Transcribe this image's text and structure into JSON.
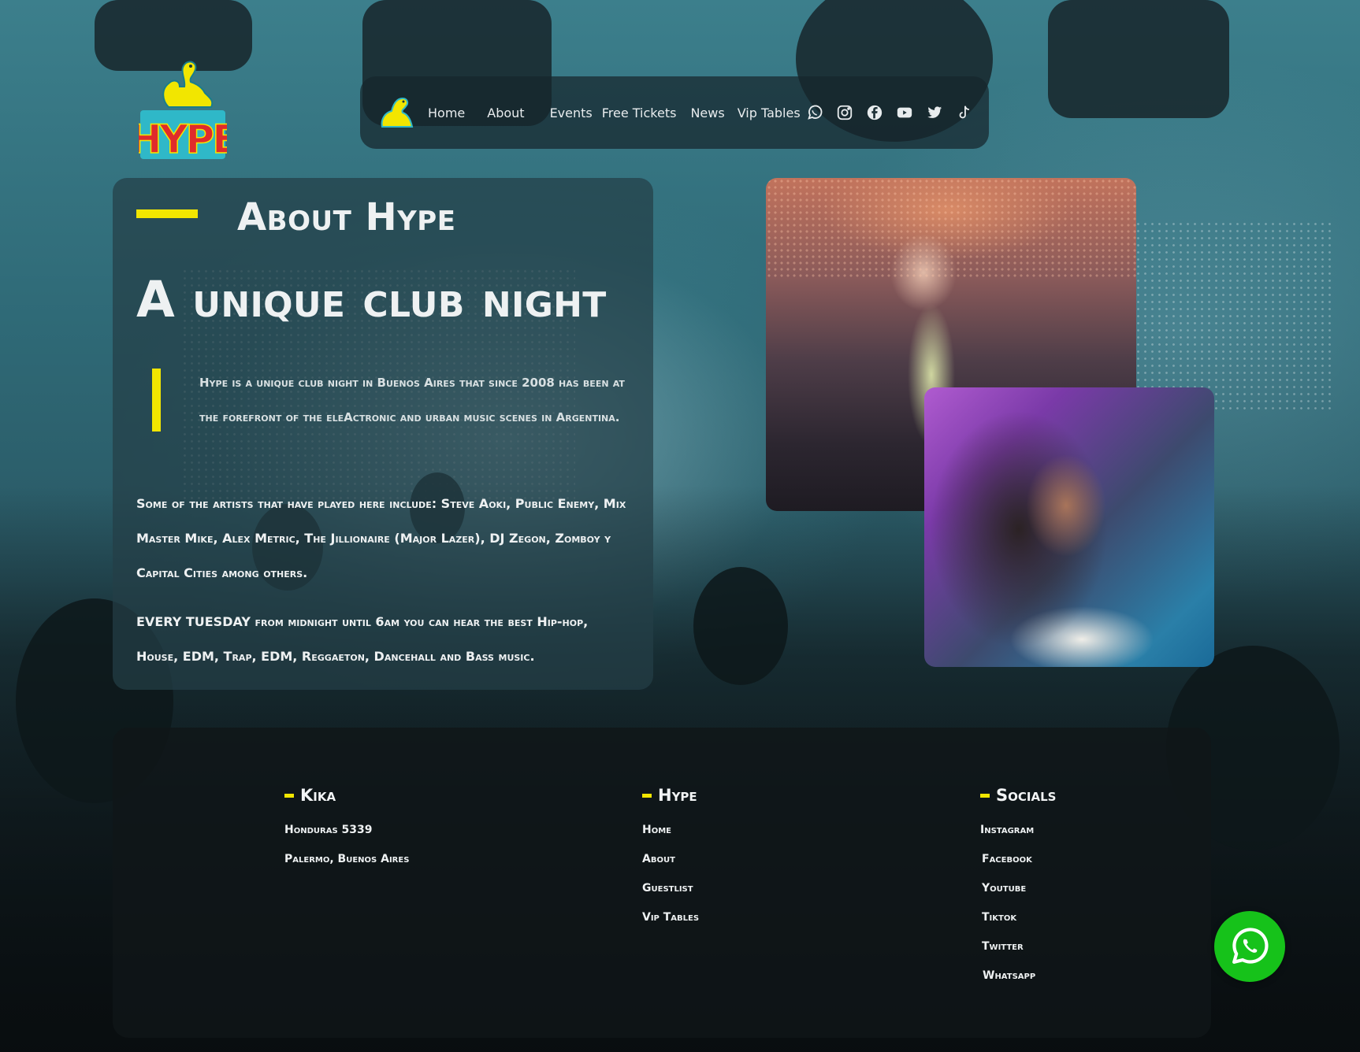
{
  "brand": {
    "logo_text": "HYPE"
  },
  "nav": {
    "links": [
      "Home",
      "About",
      "Events",
      "Free Tickets",
      "News",
      "Vip Tables"
    ],
    "socials": [
      "whatsapp-icon",
      "instagram-icon",
      "facebook-icon",
      "youtube-icon",
      "twitter-icon",
      "tiktok-icon"
    ]
  },
  "about": {
    "section_title": "About Hype",
    "headline": "A unique club night",
    "intro": "Hype is a unique club night in Buenos Aires that since 2008 has been at the forefront of the eleActronic and urban music scenes in Argentina.",
    "paragraph1": "Some of the artists that have played here include: Steve Aoki, Public Enemy, Mix Master Mike, Alex Metric, The Jillionaire (Major Lazer), DJ Zegon, Zomboy y Capital Cities among others.",
    "paragraph2": "EVERY TUESDAY from midnight until 6am you can hear the best Hip-hop, House, EDM, Trap, EDM, Reggaeton, Dancehall and Bass music."
  },
  "footer": {
    "col1": {
      "title": "Kika",
      "items": [
        "Honduras 5339",
        "Palermo, Buenos Aires"
      ]
    },
    "col2": {
      "title": "Hype",
      "items": [
        "Home",
        "About",
        "Guestlist",
        "Vip Tables"
      ]
    },
    "col3": {
      "title": "Socials",
      "items": [
        "Instagram",
        "Facebook",
        "Youtube",
        "Tiktok",
        "Twitter",
        "Whatsapp"
      ]
    }
  },
  "colors": {
    "accent": "#f2e600",
    "whatsapp": "#16c21a",
    "logo_red": "#e02b2b",
    "logo_yellow": "#f2e600",
    "logo_teal": "#2fb8c8"
  }
}
